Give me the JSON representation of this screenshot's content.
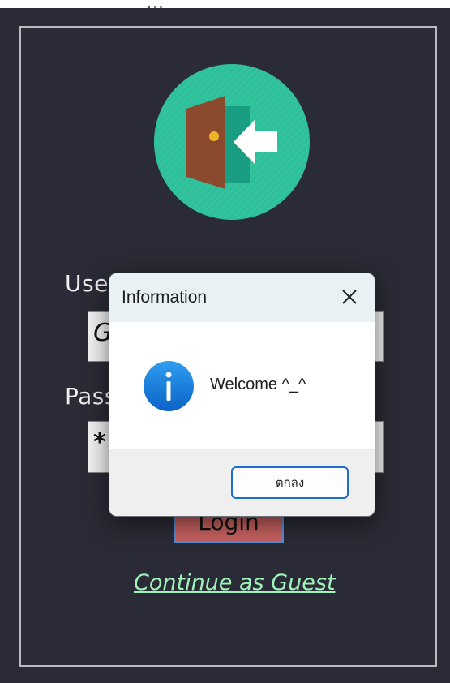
{
  "form": {
    "username_label": "Use",
    "username_value": "G",
    "password_label": "Pass",
    "password_value": "*",
    "login_label": "Login",
    "guest_link": "Continue as Guest"
  },
  "dialog": {
    "title": "Information",
    "message": "Welcome ^_^",
    "ok_label": "ตกลง",
    "icon": "info-icon",
    "close_icon": "close-icon"
  },
  "colors": {
    "background": "#2a2b36",
    "login_button": "#c6615f",
    "guest_link": "#9ff2b9",
    "logo_circle": "#2fbf9b",
    "dialog_accent": "#1c6fd0"
  }
}
